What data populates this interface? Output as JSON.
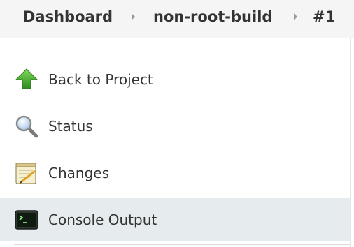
{
  "breadcrumb": {
    "items": [
      {
        "label": "Dashboard"
      },
      {
        "label": "non-root-build"
      },
      {
        "label": "#1"
      }
    ]
  },
  "tasks": [
    {
      "label": "Back to Project",
      "icon": "up-arrow-icon"
    },
    {
      "label": "Status",
      "icon": "magnifier-icon"
    },
    {
      "label": "Changes",
      "icon": "notepad-icon"
    },
    {
      "label": "Console Output",
      "icon": "terminal-icon",
      "active": true
    }
  ],
  "colors": {
    "breadcrumb_bg": "#f5f5f5",
    "active_bg": "#e6ebee",
    "text": "#333333",
    "arrow_green": "#4caf2a"
  }
}
